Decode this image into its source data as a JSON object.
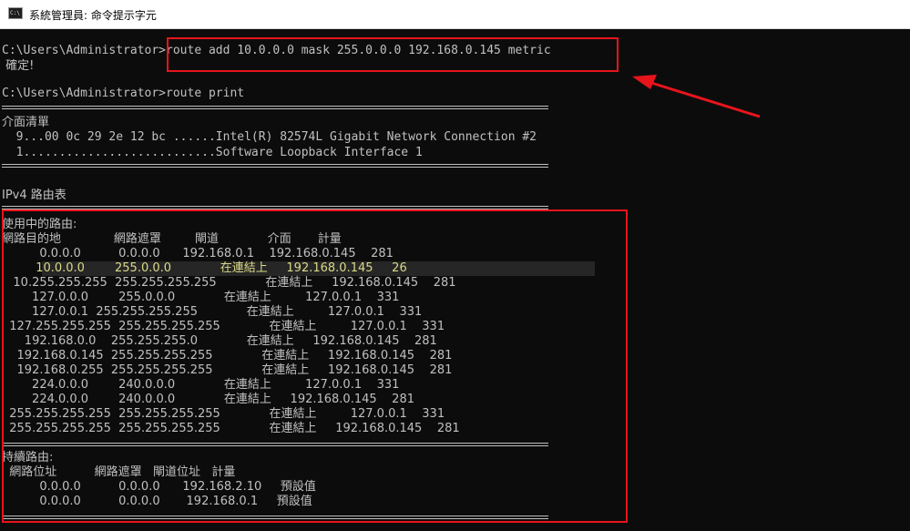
{
  "window": {
    "title": "系統管理員: 命令提示字元",
    "icon": "cmd-icon"
  },
  "console": {
    "cmd1": "C:\\Users\\Administrator>route add 10.0.0.0 mask 255.0.0.0 192.168.0.145 metric",
    "confirm": " 確定!",
    "cmd2": "C:\\Users\\Administrator>route print",
    "iface_header": "介面清單",
    "iface1": "  9...00 0c 29 2e 12 bc ......Intel(R) 82574L Gigabit Network Connection #2",
    "iface2": "  1...........................Software Loopback Interface 1",
    "ipv4_title": "IPv4 路由表",
    "active_header": "使用中的路由:",
    "active_cols": "網路目的地              網路遮罩         閘道             介面       計量",
    "routes": [
      "          0.0.0.0          0.0.0.0      192.168.0.1    192.168.0.145    281",
      "         10.0.0.0        255.0.0.0             在連結上     192.168.0.145     26",
      "   10.255.255.255  255.255.255.255             在連結上     192.168.0.145    281",
      "        127.0.0.0        255.0.0.0             在連結上         127.0.0.1    331",
      "        127.0.0.1  255.255.255.255             在連結上         127.0.0.1    331",
      "  127.255.255.255  255.255.255.255             在連結上         127.0.0.1    331",
      "      192.168.0.0    255.255.255.0             在連結上     192.168.0.145    281",
      "    192.168.0.145  255.255.255.255             在連結上     192.168.0.145    281",
      "    192.168.0.255  255.255.255.255             在連結上     192.168.0.145    281",
      "        224.0.0.0        240.0.0.0             在連結上         127.0.0.1    331",
      "        224.0.0.0        240.0.0.0             在連結上     192.168.0.145    281",
      "  255.255.255.255  255.255.255.255             在連結上         127.0.0.1    331",
      "  255.255.255.255  255.255.255.255             在連結上     192.168.0.145    281"
    ],
    "persistent_header": "持續路由:",
    "persistent_cols": "  網路位址          網路遮罩   閘道位址   計量",
    "persistent_routes": [
      "          0.0.0.0          0.0.0.0      192.168.2.10     預設值",
      "          0.0.0.0          0.0.0.0       192.168.0.1     預設值"
    ]
  },
  "colors": {
    "background": "#0c0c0c",
    "text": "#c0c0c0",
    "highlight_text": "#d9d989",
    "annotation_red": "#e8141c"
  }
}
